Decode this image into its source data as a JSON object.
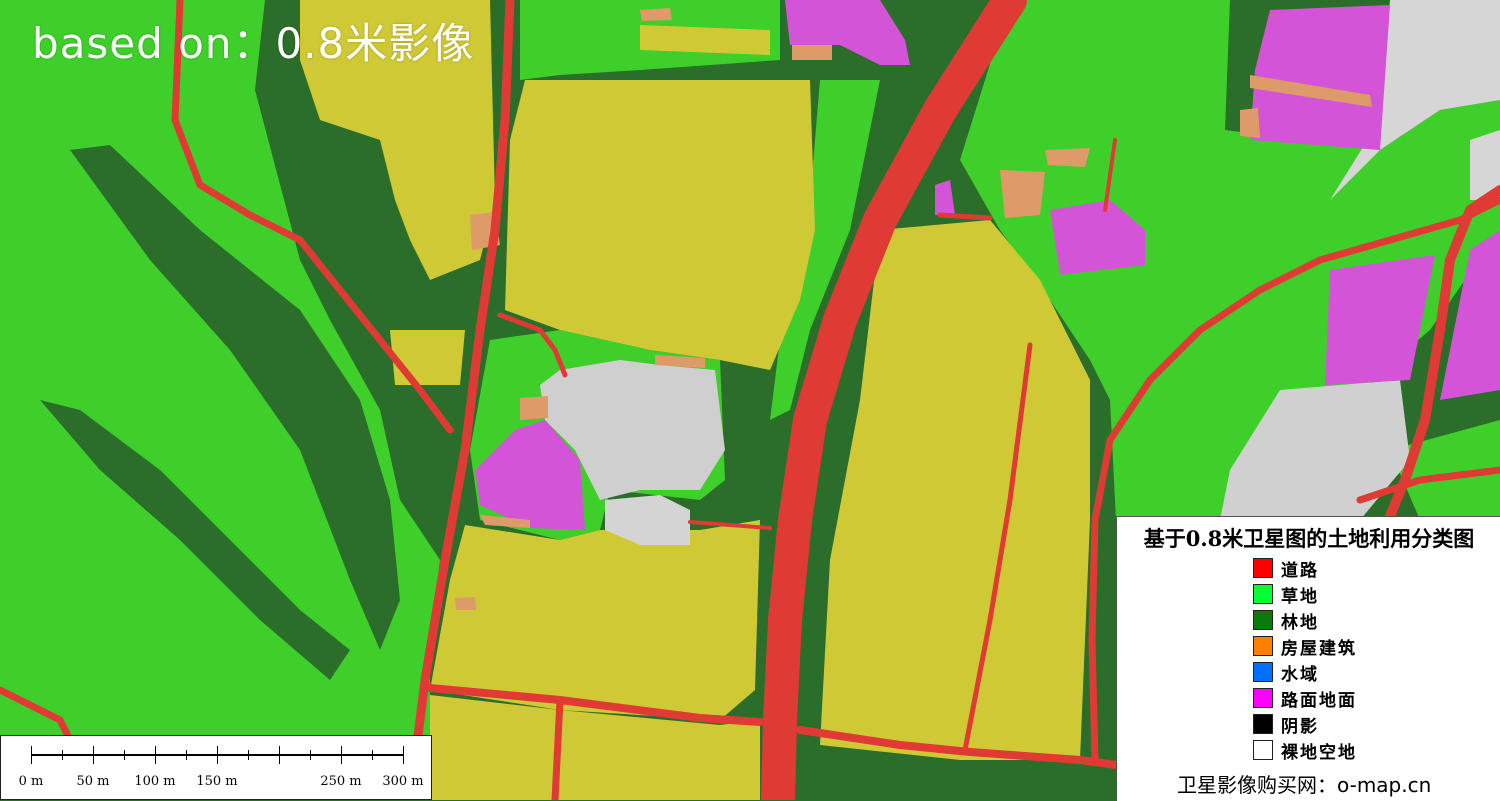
{
  "watermark": "based on：0.8米影像",
  "scale_bar": {
    "labels": [
      "0 m",
      "50 m",
      "100 m",
      "150 m",
      "250 m",
      "300 m"
    ]
  },
  "legend": {
    "title": "基于0.8米卫星图的土地利用分类图",
    "items": [
      {
        "label": "道路",
        "color": "#ff0000",
        "icon": "road-swatch"
      },
      {
        "label": "草地",
        "color": "#00ff33",
        "icon": "grassland-swatch"
      },
      {
        "label": "林地",
        "color": "#0b7a0b",
        "icon": "woodland-swatch"
      },
      {
        "label": "房屋建筑",
        "color": "#ff8000",
        "icon": "building-swatch"
      },
      {
        "label": "水域",
        "color": "#0070ff",
        "icon": "water-swatch"
      },
      {
        "label": "路面地面",
        "color": "#ff00ff",
        "icon": "pavement-swatch"
      },
      {
        "label": "阴影",
        "color": "#000000",
        "icon": "shadow-swatch"
      },
      {
        "label": "裸地空地",
        "color": "#ffffff",
        "icon": "bare-land-swatch"
      }
    ],
    "footer": "卫星影像购买网：o-map.cn"
  },
  "map_colors": {
    "grass": "#3fcf2a",
    "forest": "#2a6e2a",
    "farmland": "#cfc935",
    "road": "#e03a35",
    "building": "#df9a6a",
    "pavement": "#d454d8",
    "bare": "#cfcfcf"
  }
}
